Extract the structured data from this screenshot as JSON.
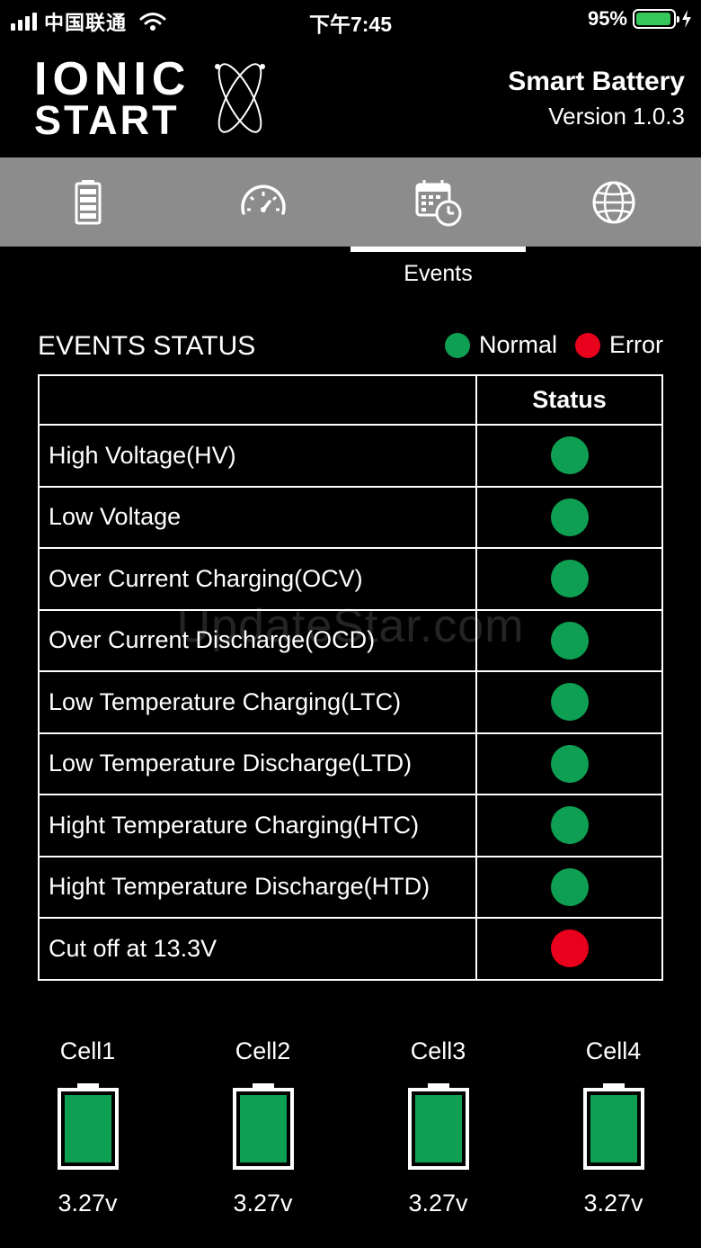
{
  "status_bar": {
    "carrier": "中国联通",
    "time": "下午7:45",
    "battery_percent": "95%",
    "battery_level": 0.95,
    "battery_color": "#35c759"
  },
  "header": {
    "logo_line1": "IONIC",
    "logo_line2": "START",
    "app_title": "Smart Battery",
    "version": "Version 1.0.3"
  },
  "tabs": [
    {
      "icon": "battery-icon",
      "label": ""
    },
    {
      "icon": "speedometer-icon",
      "label": ""
    },
    {
      "icon": "calendar-clock-icon",
      "label": "Events",
      "selected": true
    },
    {
      "icon": "globe-icon",
      "label": ""
    }
  ],
  "active_tab_caption": "Events",
  "events": {
    "title": "EVENTS STATUS",
    "legend": {
      "normal": "Normal",
      "error": "Error"
    },
    "colors": {
      "normal": "#0f9f52",
      "error": "#e8001c"
    },
    "column_header": "Status",
    "rows": [
      {
        "name": "High Voltage(HV)",
        "status": "normal"
      },
      {
        "name": "Low Voltage",
        "status": "normal"
      },
      {
        "name": "Over Current Charging(OCV)",
        "status": "normal"
      },
      {
        "name": "Over Current Discharge(OCD)",
        "status": "normal"
      },
      {
        "name": "Low Temperature Charging(LTC)",
        "status": "normal"
      },
      {
        "name": "Low Temperature Discharge(LTD)",
        "status": "normal"
      },
      {
        "name": "Hight Temperature Charging(HTC)",
        "status": "normal"
      },
      {
        "name": "Hight Temperature Discharge(HTD)",
        "status": "normal"
      },
      {
        "name": "Cut off at 13.3V",
        "status": "error"
      }
    ]
  },
  "watermark": "UpdateStar.com",
  "cells": [
    {
      "label": "Cell1",
      "voltage": "3.27v",
      "level": 1.0
    },
    {
      "label": "Cell2",
      "voltage": "3.27v",
      "level": 1.0
    },
    {
      "label": "Cell3",
      "voltage": "3.27v",
      "level": 1.0
    },
    {
      "label": "Cell4",
      "voltage": "3.27v",
      "level": 1.0
    }
  ]
}
